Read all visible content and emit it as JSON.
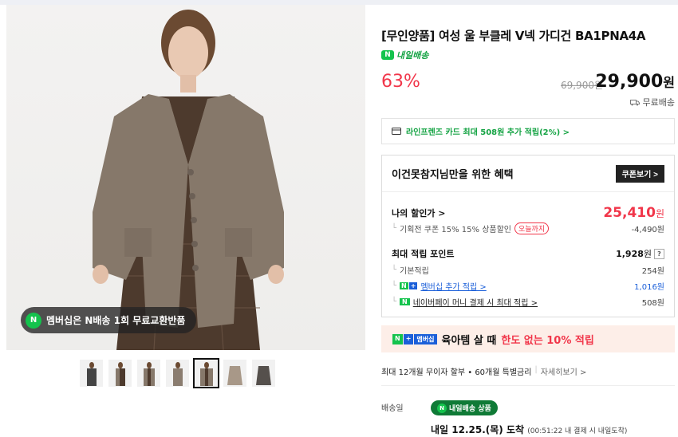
{
  "product": {
    "title": "[무인양품] 여성 울 부클레 V넥 가디건 BA1PNA4A",
    "delivery_tag": "내일배송",
    "delivery_tag_icon": "N",
    "discount_rate": "63%",
    "original_price": "69,900원",
    "sale_price_number": "29,900",
    "sale_price_unit": "원",
    "shipping": "무료배송"
  },
  "gallery": {
    "badge_icon": "N",
    "badge_text": "멤버십은 N배송 1회 무료교환반품",
    "selected_thumb": 5
  },
  "card_benefit": {
    "text": "라인프렌즈 카드 최대 508원 추가 적립(2%) >"
  },
  "benefit": {
    "heading": "이건못참지님만을 위한 혜택",
    "coupon_button": "쿠폰보기 >",
    "my_price_label": "나의 할인가 >",
    "my_price_value": "25,410",
    "my_price_unit": "원",
    "coupon_line": "기획전 쿠폰 15% 15% 상품할인",
    "coupon_badge": "오늘까지",
    "coupon_value": "-4,490원",
    "points_label": "최대 적립 포인트",
    "points_value": "1,928",
    "points_unit": "원",
    "points_help": "?",
    "basic_label": "기본적립",
    "basic_value": "254원",
    "membership_badge_a": "N",
    "membership_badge_b": "+",
    "membership_label": "멤버십 추가 적립 >",
    "membership_value": "1,016원",
    "npay_badge": "N",
    "npay_label": "네이버페이 머니 결제 시 최대 적립 >",
    "npay_value": "508원"
  },
  "promo": {
    "tag_a": "N",
    "tag_b": "+",
    "tag_c": "멤버십",
    "text_before": "육아템 살 때",
    "text_highlight": "한도 없는 10% 적립"
  },
  "install": {
    "text": "최대 12개월 무이자 할부 • 60개월 특별금리",
    "link": "자세히보기 >"
  },
  "shipping_info": {
    "label": "배송일",
    "pill_icon": "N",
    "pill_text": "내일배송 상품",
    "arrival": "내일 12.25.(목) 도착",
    "arrival_note": "(00:51:22 내 결제 시 내일도착)"
  },
  "colors": {
    "accent_red": "#f1364a",
    "naver_green": "#14c34d",
    "link_blue": "#1b5fd9"
  }
}
